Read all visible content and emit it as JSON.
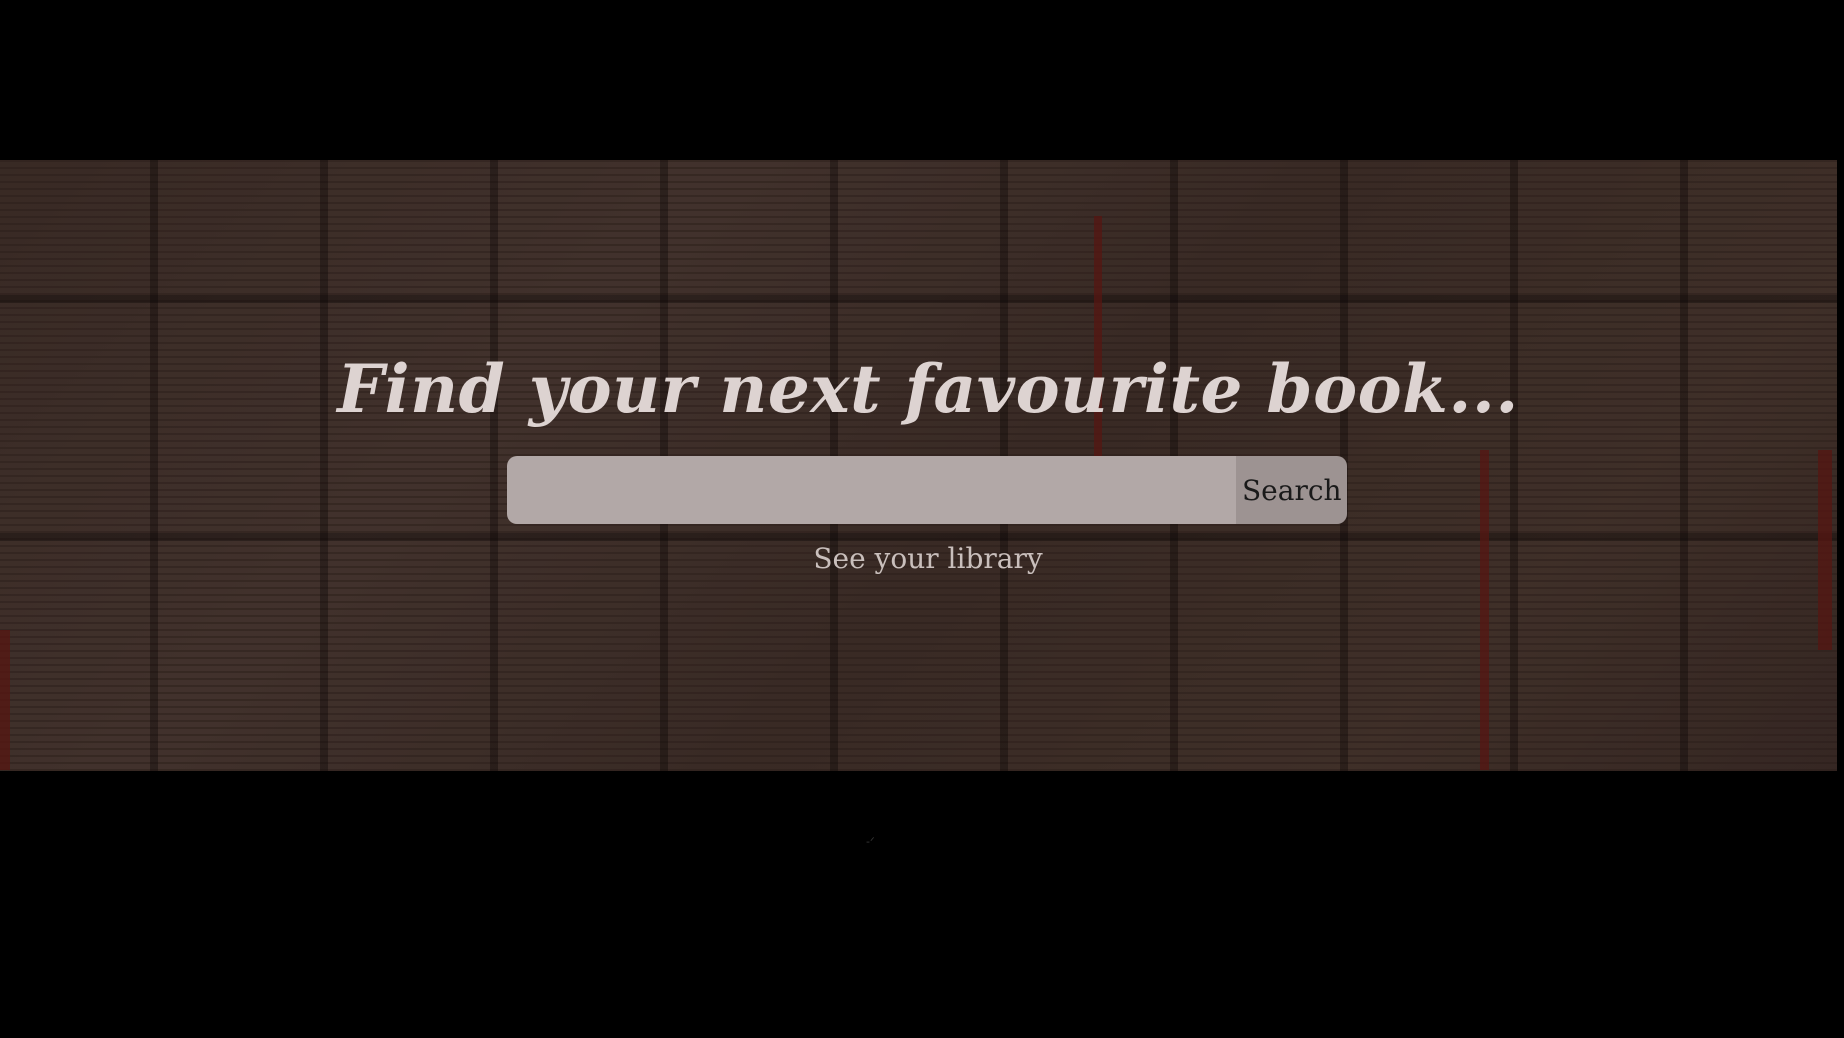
{
  "hero": {
    "title": "Find your next favourite book...",
    "background_image": "open-books-background"
  },
  "search": {
    "value": "",
    "placeholder": "",
    "button_label": "Search"
  },
  "library_link": {
    "label": "See your library"
  },
  "footer": {
    "mark": "‑ᐟ"
  },
  "colors": {
    "page_background": "#000000",
    "title_text": "#ddd3d1",
    "input_background": "#b2a8a7",
    "button_background": "#9d9392",
    "link_text": "#c9bfbc"
  }
}
